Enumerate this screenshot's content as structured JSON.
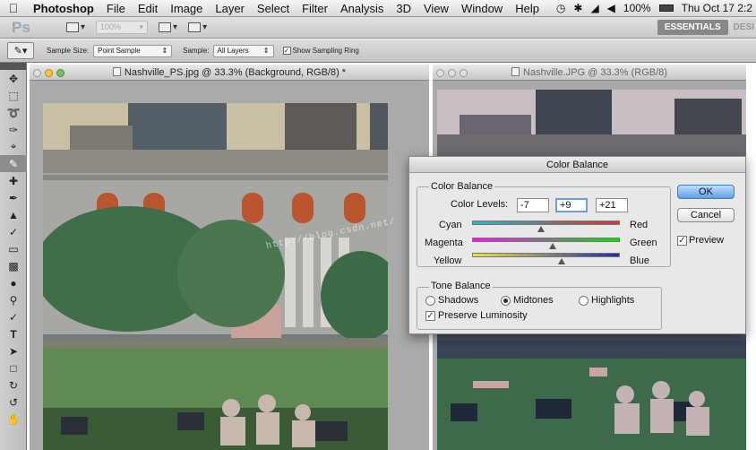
{
  "menubar": {
    "apple": "",
    "items": [
      "Photoshop",
      "File",
      "Edit",
      "Image",
      "Layer",
      "Select",
      "Filter",
      "Analysis",
      "3D",
      "View",
      "Window",
      "Help"
    ],
    "battery": "100%",
    "clock": "Thu Oct 17  2:2"
  },
  "appbar": {
    "logo": "Ps",
    "zoom": "100%",
    "workspace": "ESSENTIALS",
    "workspace_next": "DESI"
  },
  "options": {
    "sample_size_label": "Sample Size:",
    "sample_size_value": "Point Sample",
    "sample_label": "Sample:",
    "sample_value": "All Layers",
    "show_ring_label": "Show Sampling Ring",
    "show_ring_checked": true
  },
  "doc_left": {
    "title": "Nashville_PS.jpg @ 33.3% (Background, RGB/8) *"
  },
  "doc_right": {
    "title": "Nashville.JPG @ 33.3% (RGB/8)"
  },
  "dialog": {
    "title": "Color Balance",
    "color_balance_group": "Color Balance",
    "levels_label": "Color Levels:",
    "levels": [
      "-7",
      "+9",
      "+21"
    ],
    "sliders": [
      {
        "left": "Cyan",
        "right": "Red",
        "value": -7
      },
      {
        "left": "Magenta",
        "right": "Green",
        "value": 9
      },
      {
        "left": "Yellow",
        "right": "Blue",
        "value": 21
      }
    ],
    "tone_group": "Tone Balance",
    "tones": [
      "Shadows",
      "Midtones",
      "Highlights"
    ],
    "selected_tone": "Midtones",
    "preserve_label": "Preserve Luminosity",
    "preserve_checked": true,
    "ok": "OK",
    "cancel": "Cancel",
    "preview_label": "Preview",
    "preview_checked": true
  },
  "watermark": "http://blog.csdn.net/",
  "colors": {
    "accent": "#5f9fe5",
    "toolbar": "#c4c4c4",
    "dialog": "#e8e8e8"
  }
}
